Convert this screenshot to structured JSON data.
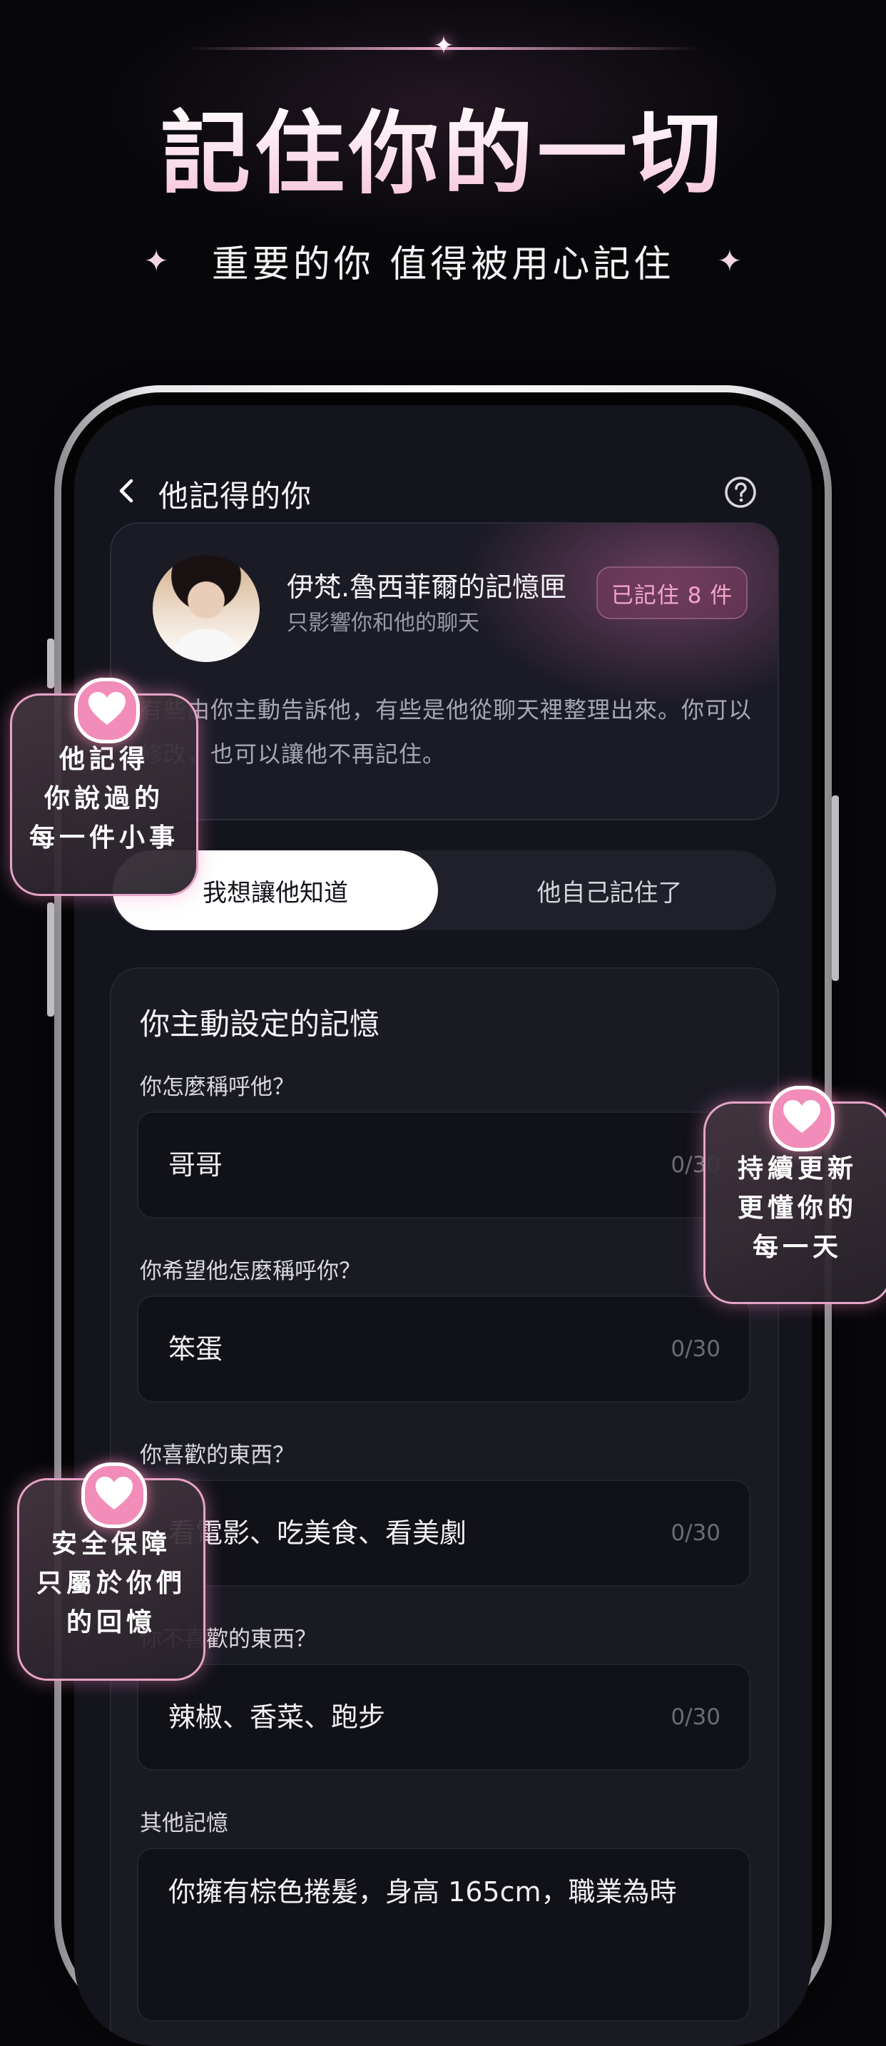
{
  "promo": {
    "headline": "記住你的一切",
    "subtitle": "重要的你 值得被用心記住"
  },
  "screen": {
    "nav": {
      "title": "他記得的你"
    },
    "profile_card": {
      "name": "伊梵.魯西菲爾的記憶匣",
      "subtitle": "只影響你和他的聊天",
      "badge": "已記住 8 件",
      "description": "有些由你主動告訴他，有些是他從聊天裡整理出來。你可以修改，也可以讓他不再記住。"
    },
    "tabs": [
      {
        "label": "我想讓他知道",
        "active": true
      },
      {
        "label": "他自己記住了",
        "active": false
      }
    ],
    "memory": {
      "title": "你主動設定的記憶",
      "fields": [
        {
          "label": "你怎麼稱呼他？",
          "value": "哥哥",
          "counter": "0/30"
        },
        {
          "label": "你希望他怎麼稱呼你？",
          "value": "笨蛋",
          "counter": "0/30"
        },
        {
          "label": "你喜歡的東西？",
          "value": "看電影、吃美食、看美劇",
          "counter": "0/30"
        },
        {
          "label": "你不喜歡的東西？",
          "value": "辣椒、香菜、跑步",
          "counter": "0/30"
        },
        {
          "label": "其他記憶",
          "value": "你擁有棕色捲髮，身高 165cm，職業為時",
          "counter": ""
        }
      ]
    }
  },
  "float_badges": [
    {
      "lines": [
        "他記得",
        "你說過的",
        "每一件小事"
      ]
    },
    {
      "lines": [
        "持續更新",
        "更懂你的",
        "每一天"
      ]
    },
    {
      "lines": [
        "安全保障",
        "只屬於你們",
        "的回憶"
      ]
    }
  ],
  "colors": {
    "background": "#07070a",
    "screen": "#14141c",
    "accent_pink": "#f18db8",
    "badge_text": "#f2a6c8"
  },
  "icons": [
    "back-arrow-icon",
    "help-circle-icon",
    "heart-icon",
    "sparkle-icon"
  ]
}
